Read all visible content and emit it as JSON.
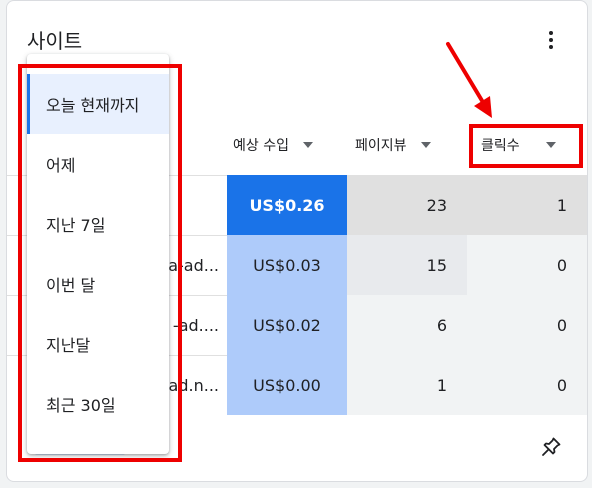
{
  "card": {
    "title": "사이트"
  },
  "columns": {
    "earnings": "예상 수입",
    "pageviews": "페이지뷰",
    "clicks": "클릭수"
  },
  "rows": [
    {
      "site": "",
      "earnings": "US$0.26",
      "pageviews": "23",
      "clicks": "1"
    },
    {
      "site": "a-ad...",
      "earnings": "US$0.03",
      "pageviews": "15",
      "clicks": "0"
    },
    {
      "site": "-ad....",
      "earnings": "US$0.02",
      "pageviews": "6",
      "clicks": "0"
    },
    {
      "site": "ad.n...",
      "earnings": "US$0.00",
      "pageviews": "1",
      "clicks": "0"
    }
  ],
  "date_menu": {
    "items": [
      "오늘 현재까지",
      "어제",
      "지난 7일",
      "이번 달",
      "지난달",
      "최근 30일"
    ],
    "selected": "오늘 현재까지"
  },
  "colors": {
    "accent": "#1a73e8",
    "earnings_highlight": "#1a73e8",
    "earnings_light": "#aecbfa",
    "annotation": "#ee0000"
  },
  "icons": {
    "more": "more-vert-icon",
    "pin": "pin-icon",
    "sort": "sort-caret-icon"
  }
}
